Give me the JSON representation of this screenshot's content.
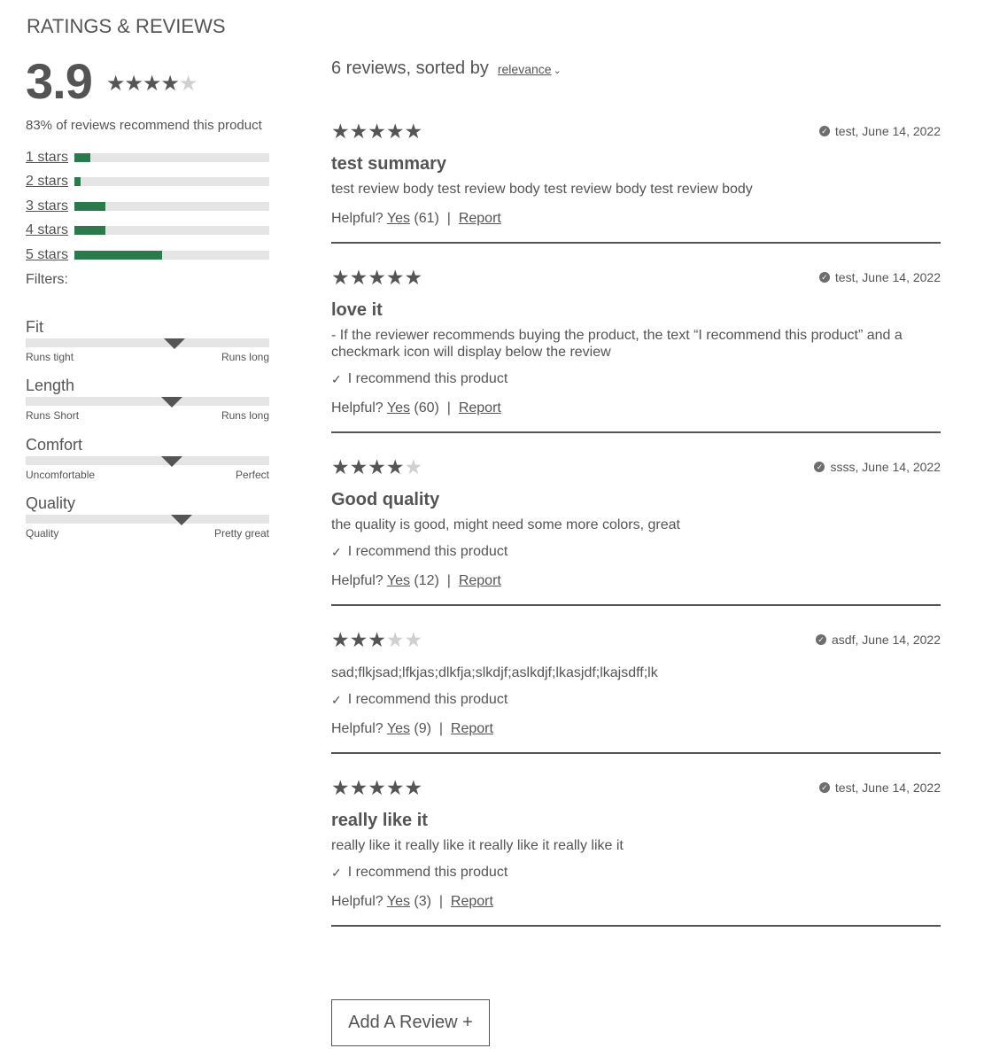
{
  "heading": "RATINGS & REVIEWS",
  "overall": {
    "rating": "3.9",
    "stars_filled": 4,
    "stars_total": 5
  },
  "recommend_pct_text": "83% of reviews recommend this product",
  "breakdown": [
    {
      "label": "1 stars",
      "fraction": 0.08
    },
    {
      "label": "2 stars",
      "fraction": 0.03
    },
    {
      "label": "3 stars",
      "fraction": 0.16
    },
    {
      "label": "4 stars",
      "fraction": 0.16
    },
    {
      "label": "5 stars",
      "fraction": 0.45
    }
  ],
  "filters_label": "Filters:",
  "characteristics": [
    {
      "name": "Fit",
      "low": "Runs tight",
      "high": "Runs long",
      "value": 0.61
    },
    {
      "name": "Length",
      "low": "Runs Short",
      "high": "Runs long",
      "value": 0.6
    },
    {
      "name": "Comfort",
      "low": "Uncomfortable",
      "high": "Perfect",
      "value": 0.6
    },
    {
      "name": "Quality",
      "low": "Quality",
      "high": "Pretty great",
      "value": 0.64
    }
  ],
  "list_header": {
    "count_text": "6 reviews, sorted by",
    "sort_value": "relevance",
    "sort_chevron": "chevron-down-icon"
  },
  "reviews": [
    {
      "stars": 5,
      "meta": "test, June 14, 2022",
      "title": "test summary",
      "body": "test review body test review body test review body test review body",
      "recommend": "",
      "helpful_q": "Helpful?",
      "yes": "Yes",
      "count": "(61)",
      "report": "Report"
    },
    {
      "stars": 5,
      "meta": "test, June 14, 2022",
      "title": "love it",
      "body": "- If the reviewer recommends buying the product, the text “I recommend this product” and a checkmark icon will display below the review",
      "recommend": "I recommend this product",
      "helpful_q": "Helpful?",
      "yes": "Yes",
      "count": "(60)",
      "report": "Report"
    },
    {
      "stars": 4,
      "meta": "ssss, June 14, 2022",
      "title": "Good quality",
      "body": "the quality is good, might need some more colors, great",
      "recommend": "I recommend this product",
      "helpful_q": "Helpful?",
      "yes": "Yes",
      "count": "(12)",
      "report": "Report"
    },
    {
      "stars": 3,
      "meta": "asdf, June 14, 2022",
      "title": "",
      "body": "sad;flkjsad;lfkjas;dlkfja;slkdjf;aslkdjf;lkasjdf;lkajsdff;lk",
      "recommend": "I recommend this product",
      "helpful_q": "Helpful?",
      "yes": "Yes",
      "count": "(9)",
      "report": "Report"
    },
    {
      "stars": 5,
      "meta": "test, June 14, 2022",
      "title": "really like it",
      "body": "really like it really like it really like it really like it",
      "recommend": "I recommend this product",
      "helpful_q": "Helpful?",
      "yes": "Yes",
      "count": "(3)",
      "report": "Report"
    }
  ],
  "add_review_label": "Add A Review +",
  "colors": {
    "bar_fill": "#2a7a4b",
    "text": "#545454",
    "star_on": "#555555",
    "star_off": "#d0d0d0"
  }
}
